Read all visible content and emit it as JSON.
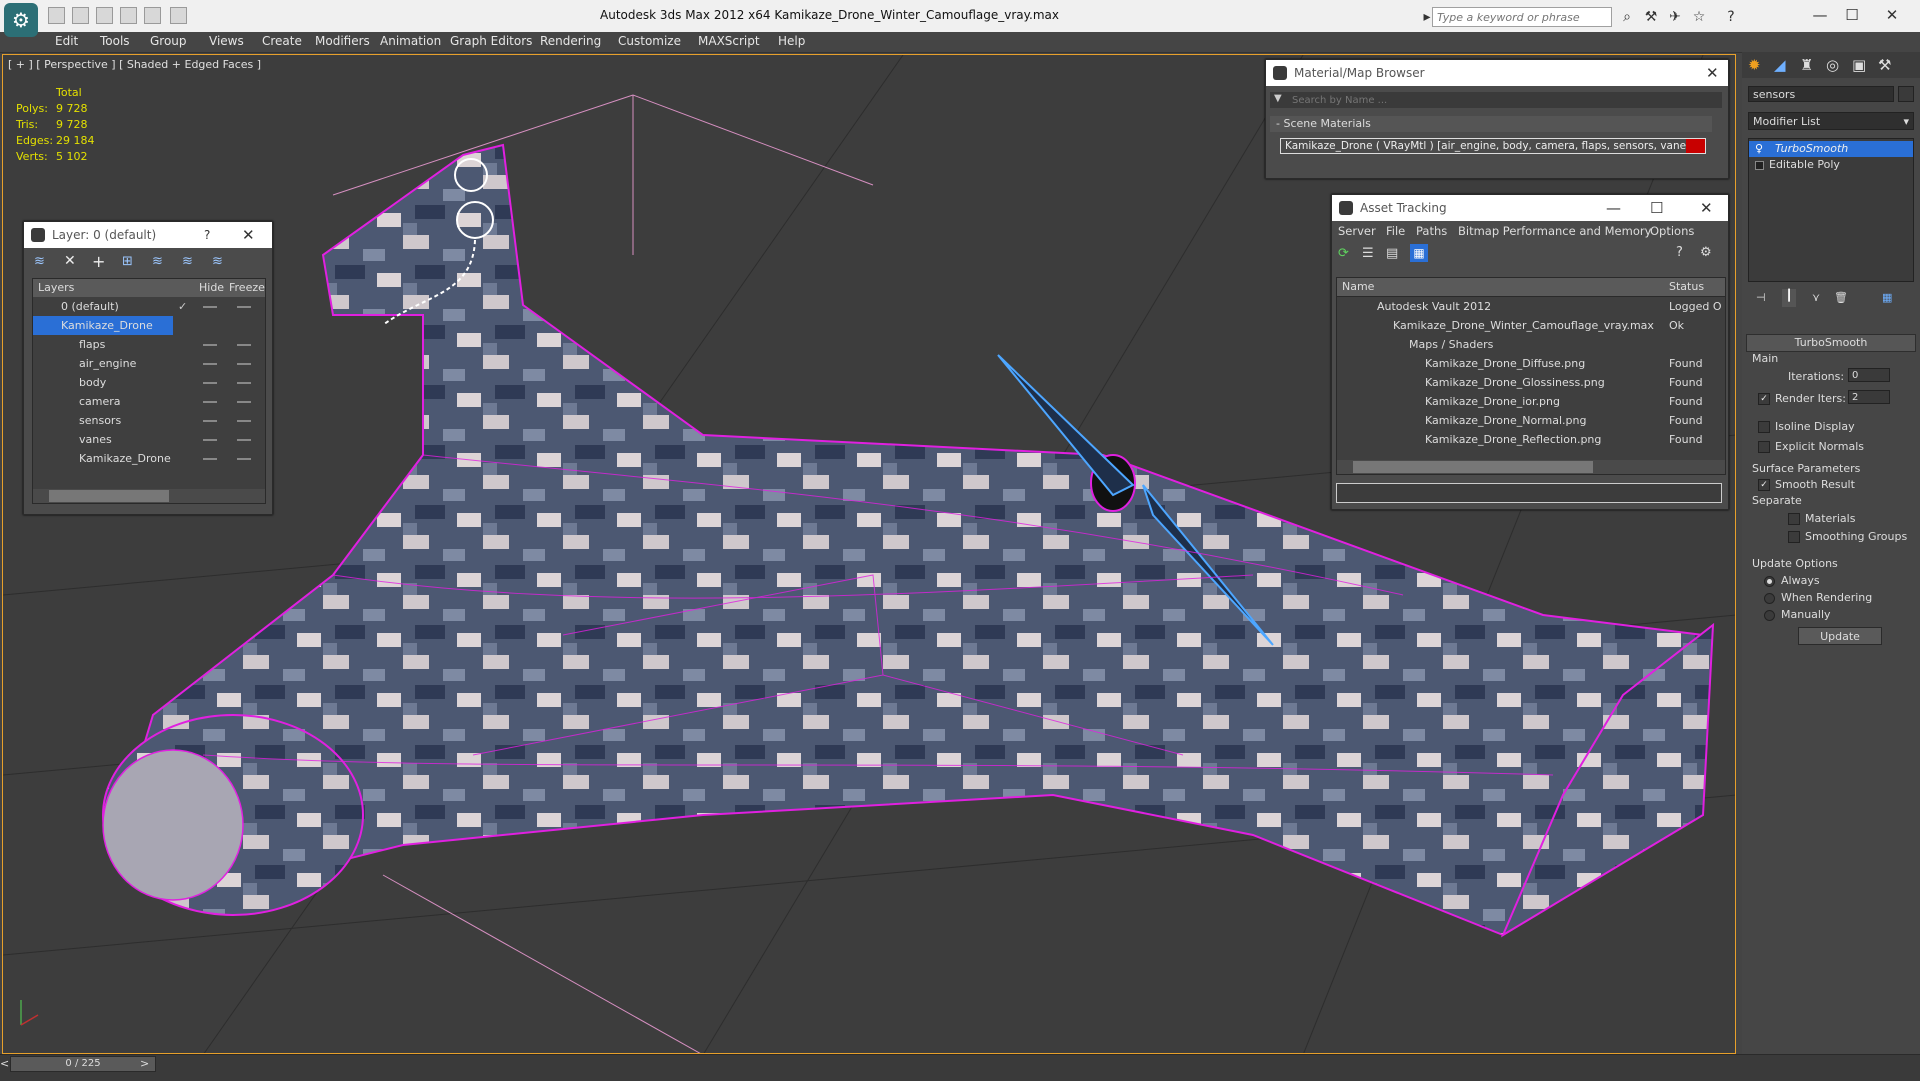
{
  "window": {
    "title": "Autodesk 3ds Max  2012 x64      Kamikaze_Drone_Winter_Camouflage_vray.max",
    "search_placeholder": "Type a keyword or phrase"
  },
  "menu": [
    "Edit",
    "Tools",
    "Group",
    "Views",
    "Create",
    "Modifiers",
    "Animation",
    "Graph Editors",
    "Rendering",
    "Customize",
    "MAXScript",
    "Help"
  ],
  "viewport": {
    "label": "[ + ] [ Perspective ] [ Shaded + Edged Faces ]",
    "stats_header": "Total",
    "stats": [
      {
        "label": "Polys:",
        "value": "9 728"
      },
      {
        "label": "Tris:",
        "value": "9 728"
      },
      {
        "label": "Edges:",
        "value": "29 184"
      },
      {
        "label": "Verts:",
        "value": "5 102"
      }
    ]
  },
  "layer_window": {
    "title": "Layer: 0 (default)",
    "help": "?",
    "columns": [
      "Layers",
      "Hide",
      "Freeze"
    ],
    "rows": [
      {
        "name": "0 (default)",
        "selected": false
      },
      {
        "name": "Kamikaze_Drone",
        "selected": true
      },
      {
        "name": "flaps",
        "selected": false
      },
      {
        "name": "air_engine",
        "selected": false
      },
      {
        "name": "body",
        "selected": false
      },
      {
        "name": "camera",
        "selected": false
      },
      {
        "name": "sensors",
        "selected": false
      },
      {
        "name": "vanes",
        "selected": false
      },
      {
        "name": "Kamikaze_Drone",
        "selected": false
      }
    ]
  },
  "material_browser": {
    "title": "Material/Map Browser",
    "search_placeholder": "Search by Name ...",
    "section": "- Scene Materials",
    "material": "Kamikaze_Drone  ( VRayMtl ) [air_engine, body, camera, flaps, sensors, vanes]"
  },
  "asset_tracking": {
    "title": "Asset Tracking",
    "menu": [
      "Server",
      "File",
      "Paths",
      "Bitmap Performance and Memory",
      "Options"
    ],
    "columns": [
      "Name",
      "Status"
    ],
    "rows": [
      {
        "name": "Autodesk Vault 2012",
        "status": "Logged O",
        "indent": 1
      },
      {
        "name": "Kamikaze_Drone_Winter_Camouflage_vray.max",
        "status": "Ok",
        "indent": 2
      },
      {
        "name": "Maps / Shaders",
        "status": "",
        "indent": 3
      },
      {
        "name": "Kamikaze_Drone_Diffuse.png",
        "status": "Found",
        "indent": 4
      },
      {
        "name": "Kamikaze_Drone_Glossiness.png",
        "status": "Found",
        "indent": 4
      },
      {
        "name": "Kamikaze_Drone_ior.png",
        "status": "Found",
        "indent": 4
      },
      {
        "name": "Kamikaze_Drone_Normal.png",
        "status": "Found",
        "indent": 4
      },
      {
        "name": "Kamikaze_Drone_Reflection.png",
        "status": "Found",
        "indent": 4
      }
    ]
  },
  "command_panel": {
    "object_name": "sensors",
    "modifier_list": "Modifier List",
    "stack": [
      "TurboSmooth",
      "Editable Poly"
    ],
    "turbosmooth": {
      "title": "TurboSmooth",
      "main": "Main",
      "iterations_label": "Iterations:",
      "iterations": "0",
      "render_iters_label": "Render Iters:",
      "render_iters": "2",
      "isoline": "Isoline Display",
      "explicit": "Explicit Normals",
      "surface": "Surface Parameters",
      "smooth_result": "Smooth Result",
      "separate": "Separate",
      "materials": "Materials",
      "smoothing_groups": "Smoothing Groups",
      "update_options": "Update Options",
      "always": "Always",
      "when_rendering": "When Rendering",
      "manually": "Manually",
      "update": "Update"
    }
  },
  "timeline": {
    "frame": "0 / 225"
  },
  "colors": {
    "accent": "#2a6fd6",
    "wire": "#e020e0",
    "stats": "#e3e000",
    "viewport_border": "#e7a02b"
  }
}
